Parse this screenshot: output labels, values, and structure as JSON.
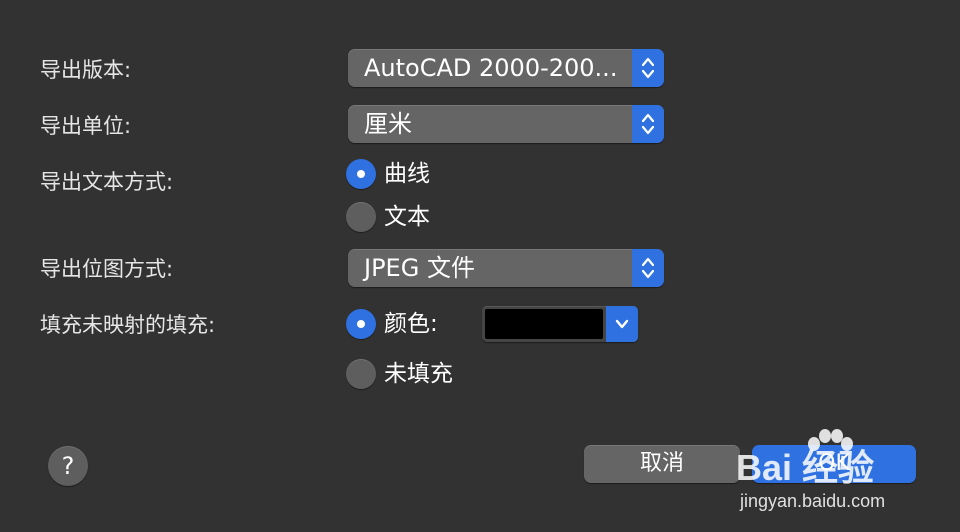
{
  "form": {
    "export_version": {
      "label": "导出版本:",
      "value": "AutoCAD 2000-200..."
    },
    "export_units": {
      "label": "导出单位:",
      "value": "厘米"
    },
    "export_text_mode": {
      "label": "导出文本方式:",
      "options": [
        {
          "label": "曲线",
          "selected": true
        },
        {
          "label": "文本",
          "selected": false
        }
      ]
    },
    "export_bitmap_mode": {
      "label": "导出位图方式:",
      "value": "JPEG 文件"
    },
    "unmapped_fill": {
      "label": "填充未映射的填充:",
      "options": [
        {
          "label": "颜色:",
          "selected": true
        },
        {
          "label": "未填充",
          "selected": false
        }
      ],
      "color_value": "#000000"
    }
  },
  "buttons": {
    "help": "?",
    "cancel": "取消",
    "ok": "OK"
  },
  "watermark": {
    "logo": "Bai 经验",
    "url": "jingyan.baidu.com"
  },
  "colors": {
    "background": "#323232",
    "control": "#656565",
    "accent": "#2f71e0"
  }
}
